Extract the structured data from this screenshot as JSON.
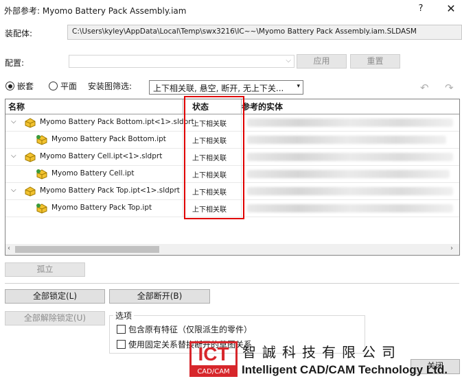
{
  "window": {
    "title": "外部参考:   Myomo Battery Pack Assembly.iam",
    "help": "?",
    "close": "✕"
  },
  "assembly": {
    "label": "装配体:",
    "path": "C:\\Users\\kyley\\AppData\\Local\\Temp\\swx3216\\IC~~\\Myomo Battery Pack Assembly.iam.SLDASM"
  },
  "config": {
    "label": "配置:",
    "value": "",
    "apply_label": "应用",
    "reset_label": "重置"
  },
  "view_mode": {
    "nested_label": "嵌套",
    "flat_label": "平面",
    "selected": "nested"
  },
  "filter": {
    "label": "安装图筛选:",
    "value": "上下相关联, 悬空, 断开, 无上下关..."
  },
  "tree": {
    "columns": [
      "名称",
      "状态",
      "参考的实体"
    ],
    "rows": [
      {
        "name": "Myomo Battery Pack Bottom.ipt<1>.sldprt",
        "status": "上下相关联",
        "level": 0,
        "expanded": true
      },
      {
        "name": "Myomo Battery Pack Bottom.ipt",
        "status": "上下相关联",
        "level": 1,
        "expanded": false
      },
      {
        "name": "Myomo Battery Cell.ipt<1>.sldprt",
        "status": "上下相关联",
        "level": 0,
        "expanded": true
      },
      {
        "name": "Myomo Battery Cell.ipt",
        "status": "上下相关联",
        "level": 1,
        "expanded": false
      },
      {
        "name": "Myomo Battery Pack Top.ipt<1>.sldprt",
        "status": "上下相关联",
        "level": 0,
        "expanded": true
      },
      {
        "name": "Myomo Battery Pack Top.ipt",
        "status": "上下相关联",
        "level": 1,
        "expanded": false
      }
    ]
  },
  "buttons": {
    "isolate": "孤立",
    "lock_all": "全部锁定(L)",
    "break_all": "全部断开(B)",
    "unlock_all": "全部解除锁定(U)",
    "close": "关闭"
  },
  "options": {
    "title": "选项",
    "include_features": "包含原有特征（仅限派生的零件）",
    "replace_relations": "使用固定关系替换断开的草图关系",
    "include_features_checked": false,
    "replace_relations_checked": false
  },
  "watermark": {
    "logo_text": "ICT",
    "logo_sub": "CAD/CAM",
    "company_cn": "智誠科技有限公司",
    "company_en": "Intelligent CAD/CAM Technology Ltd.",
    "brand_color": "#d7262b"
  }
}
